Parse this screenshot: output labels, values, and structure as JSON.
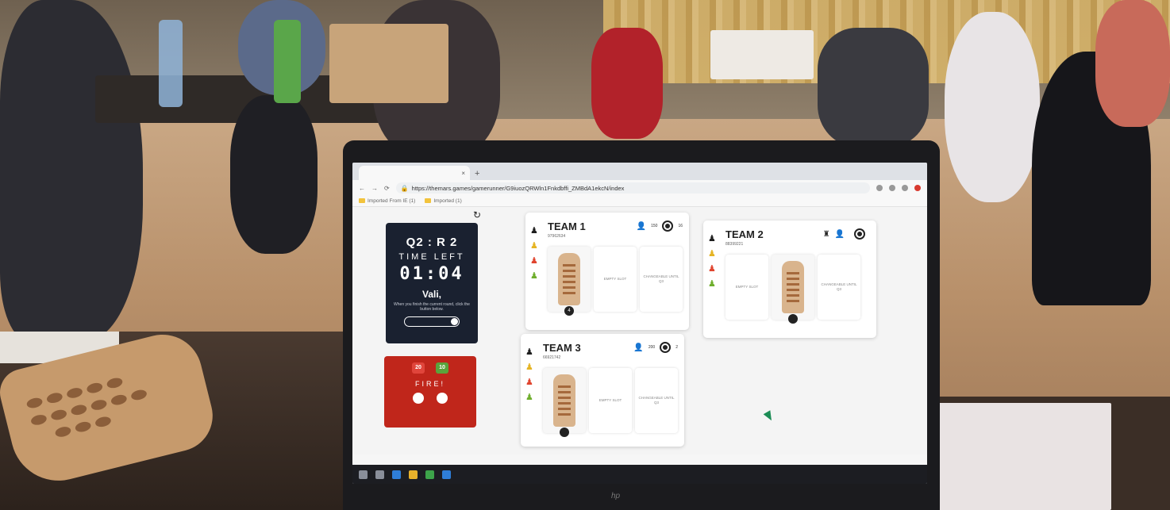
{
  "browser": {
    "tab_title": "",
    "url": "https://themars.games/gamerunner/G9iuozQRWln1Fnkdbffi_ZMBdA1ekcN/index",
    "bookmarks": [
      "Imported From IE (1)",
      "Imported (1)"
    ]
  },
  "timer": {
    "round": "Q2 : R 2",
    "label": "TIME LEFT",
    "time": "01:04",
    "player": "Vali,",
    "note": "When you finish the current round, click the button below."
  },
  "fire": {
    "badge_red": "20",
    "badge_green": "10",
    "title": "FIRE!",
    "note": ""
  },
  "teams": [
    {
      "name": "TEAM 1",
      "code": "97962634",
      "people": "150",
      "medals": "16",
      "slots": [
        "",
        "EMPTY SLOT",
        "CHANGEABLE UNTIL Q3"
      ],
      "piece_count": "4"
    },
    {
      "name": "TEAM 2",
      "code": "88399221",
      "people": "",
      "medals": "",
      "slots": [
        "EMPTY SLOT",
        "",
        "CHANGEABLE UNTIL Q3"
      ],
      "piece_count": ""
    },
    {
      "name": "TEAM 3",
      "code": "66921742",
      "people": "200",
      "medals": "2",
      "slots": [
        "",
        "EMPTY SLOT",
        "CHANGEABLE UNTIL Q3"
      ],
      "piece_count": ""
    }
  ],
  "colors": {
    "timer_bg": "#1a2130",
    "fire_bg": "#c0261b",
    "player_black": "#1e1e1e",
    "player_yellow": "#e5b424",
    "player_red": "#e0452f",
    "player_green": "#6fae2d"
  }
}
